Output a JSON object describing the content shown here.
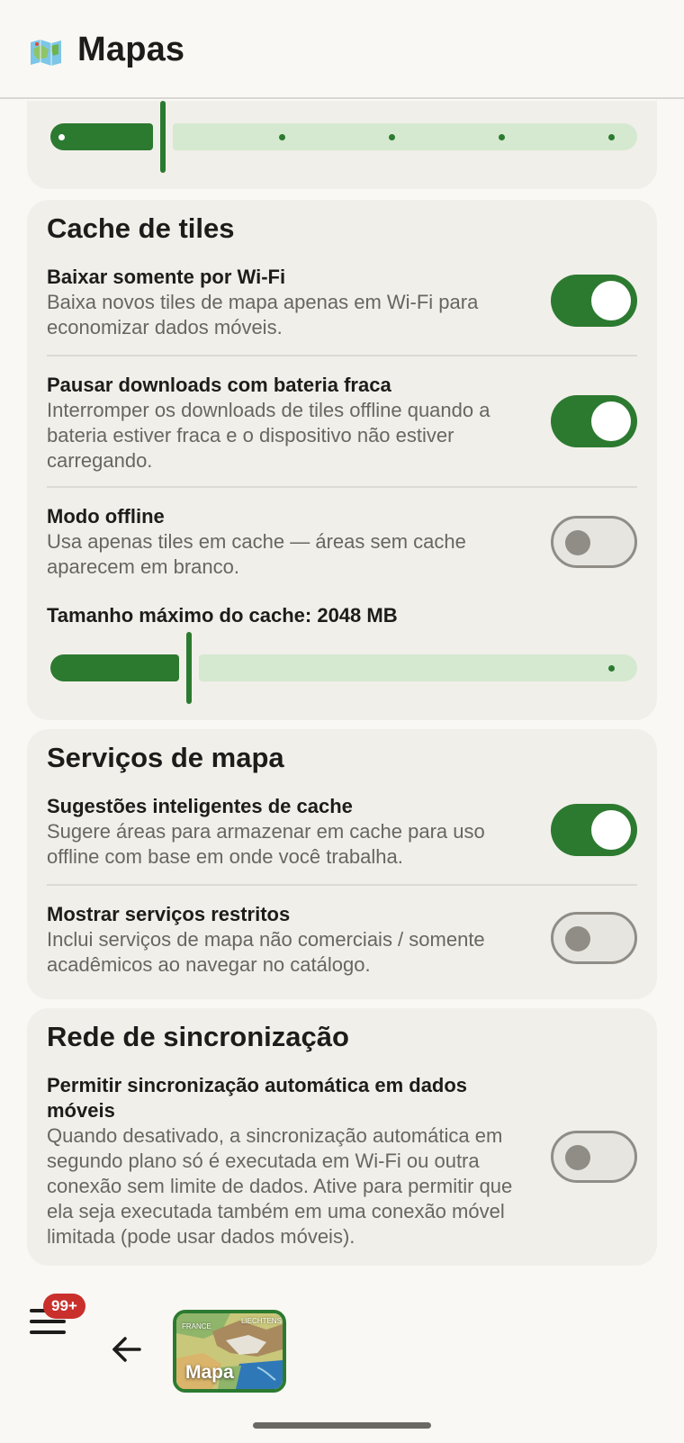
{
  "app": {
    "title": "Mapas"
  },
  "cards": {
    "top_slider": {
      "thumb_fraction": 0.2,
      "tick_count": 5
    },
    "cache": {
      "title": "Cache de tiles",
      "settings": [
        {
          "title": "Baixar somente por Wi-Fi",
          "description": "Baixa novos tiles de mapa apenas em Wi-Fi para economizar dados móveis.",
          "enabled": true
        },
        {
          "title": "Pausar downloads com bateria fraca",
          "description": "Interromper os downloads de tiles offline quando a bateria estiver fraca e o dispositivo não estiver carregando.",
          "enabled": true
        },
        {
          "title": "Modo offline",
          "description": "Usa apenas tiles em cache — áreas sem cache aparecem em branco.",
          "enabled": false
        }
      ],
      "max_size_label": "Tamanho máximo do cache: 2048 MB",
      "max_size_fraction": 0.24
    },
    "services": {
      "title": "Serviços de mapa",
      "settings": [
        {
          "title": "Sugestões inteligentes de cache",
          "description": "Sugere áreas para armazenar em cache para uso offline com base em onde você trabalha.",
          "enabled": true
        },
        {
          "title": "Mostrar serviços restritos",
          "description": "Inclui serviços de mapa não comerciais / somente acadêmicos ao navegar no catálogo.",
          "enabled": false
        }
      ]
    },
    "sync": {
      "title": "Rede de sincronização",
      "settings": [
        {
          "title": "Permitir sincronização automática em dados móveis",
          "description": "Quando desativado, a sincronização automática em segundo plano só é executada em Wi-Fi ou outra conexão sem limite de dados. Ative para permitir que ela seja executada também em uma conexão móvel limitada (pode usar dados móveis).",
          "enabled": false
        }
      ]
    }
  },
  "bottom": {
    "badge": "99+",
    "map_label": "Mapa",
    "map_place_1": "FRANCE",
    "map_place_2": "LIECHTENS"
  },
  "colors": {
    "accent": "#2c7a30",
    "accent_light": "#d4e9d0",
    "badge": "#c9302c",
    "card": "#f1efea",
    "background": "#f9f8f4"
  }
}
